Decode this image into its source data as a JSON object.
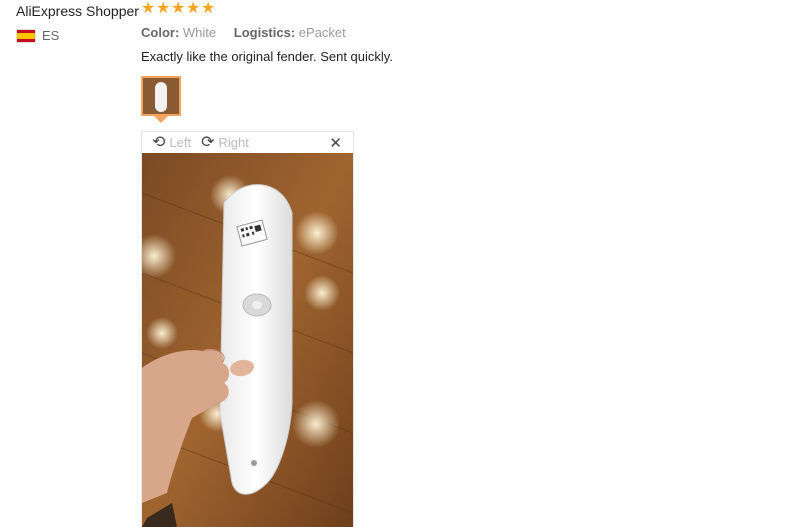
{
  "review": {
    "reviewer_name": "AliExpress Shopper",
    "rating": 5,
    "country_code": "ES",
    "color_label": "Color:",
    "color_value": "White",
    "logistics_label": "Logistics:",
    "logistics_value": "ePacket",
    "text": "Exactly like the original fender. Sent quickly."
  },
  "viewer": {
    "rotate_left_label": "Left",
    "rotate_right_label": "Right"
  },
  "icons": {
    "star": "star-icon",
    "flag": "spain-flag-icon",
    "rotate_left": "rotate-left-icon",
    "rotate_right": "rotate-right-icon",
    "close": "close-icon"
  },
  "colors": {
    "star": "#f6a623",
    "thumb_border": "#f4a460"
  }
}
